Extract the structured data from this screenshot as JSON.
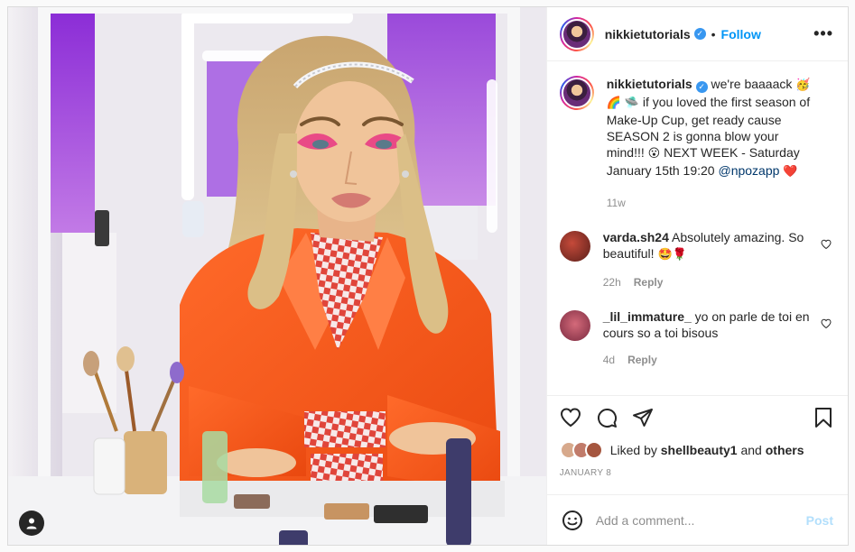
{
  "header": {
    "username": "nikkietutorials",
    "separator": "•",
    "follow_label": "Follow",
    "more_label": "•••"
  },
  "caption": {
    "username": "nikkietutorials",
    "text_1": "we're baaaack",
    "emoji_1": "🥳🌈",
    "emoji_2": "🛸",
    "text_2": "if you loved the first season of Make-Up Cup, get ready cause SEASON 2 is gonna blow your mind!!!",
    "emoji_3": "😮",
    "text_3": "NEXT WEEK - Saturday January 15th 19:20",
    "mention": "@npozapp",
    "emoji_4": "❤️",
    "time": "11w"
  },
  "comments": [
    {
      "username": "varda.sh24",
      "text": "Absolutely amazing. So beautiful!",
      "emoji": "🤩🌹",
      "time": "22h",
      "reply_label": "Reply"
    },
    {
      "username": "_lil_immature_",
      "text": "yo on parle de toi en cours so a toi bisous",
      "emoji": "",
      "time": "4d",
      "reply_label": "Reply"
    }
  ],
  "likes": {
    "prefix": "Liked by",
    "user": "shellbeauty1",
    "joiner": "and",
    "others": "others"
  },
  "date": "JANUARY 8",
  "add_comment": {
    "placeholder": "Add a comment...",
    "post_label": "Post"
  },
  "colors": {
    "accent": "#0095f6",
    "post_disabled": "#b2dffc",
    "muted": "#8e8e8e",
    "jacket": "#f45a1c",
    "lighting": "#b15ae8"
  },
  "icons": {
    "verified": "verified-badge-icon",
    "like": "heart-icon",
    "comment": "comment-icon",
    "share": "paper-plane-icon",
    "save": "bookmark-icon",
    "emoji": "emoji-icon",
    "user_tag": "user-tag-icon"
  }
}
